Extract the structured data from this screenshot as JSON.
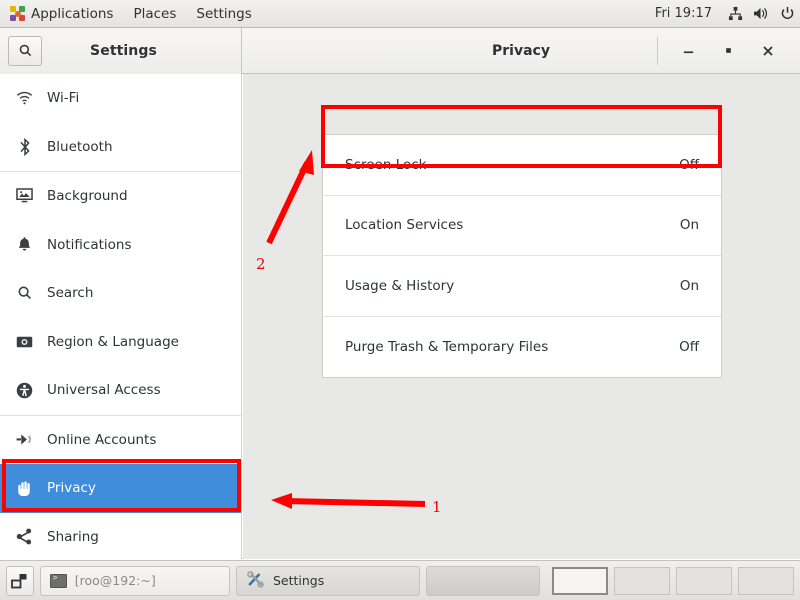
{
  "top_panel": {
    "applications_label": "Applications",
    "places_label": "Places",
    "settings_label": "Settings",
    "clock": "Fri 19:17",
    "tray": [
      "network-icon",
      "volume-icon",
      "power-icon"
    ]
  },
  "window": {
    "sidebar_header_title": "Settings",
    "search_icon": "search-icon",
    "content_title": "Privacy",
    "controls": {
      "minimize": "minimize-icon",
      "maximize": "maximize-icon",
      "close": "close-icon"
    }
  },
  "sidebar": {
    "items": [
      {
        "label": "Wi-Fi",
        "icon": "wifi-icon",
        "selected": false
      },
      {
        "label": "Bluetooth",
        "icon": "bluetooth-icon",
        "selected": false
      },
      {
        "label": "Background",
        "icon": "background-icon",
        "selected": false
      },
      {
        "label": "Notifications",
        "icon": "bell-icon",
        "selected": false
      },
      {
        "label": "Search",
        "icon": "search-icon",
        "selected": false
      },
      {
        "label": "Region & Language",
        "icon": "region-icon",
        "selected": false
      },
      {
        "label": "Universal Access",
        "icon": "accessibility-icon",
        "selected": false
      },
      {
        "label": "Online Accounts",
        "icon": "online-accounts-icon",
        "selected": false
      },
      {
        "label": "Privacy",
        "icon": "hand-icon",
        "selected": true
      },
      {
        "label": "Sharing",
        "icon": "share-icon",
        "selected": false
      }
    ]
  },
  "privacy_panel": {
    "rows": [
      {
        "label": "Screen Lock",
        "value": "Off"
      },
      {
        "label": "Location Services",
        "value": "On"
      },
      {
        "label": "Usage & History",
        "value": "On"
      },
      {
        "label": "Purge Trash & Temporary Files",
        "value": "Off"
      }
    ]
  },
  "annotations": {
    "color": "#ff0000",
    "marks": [
      {
        "number": "1",
        "points_to": "Privacy sidebar item"
      },
      {
        "number": "2",
        "points_to": "Screen Lock row"
      }
    ],
    "highlight_boxes": [
      "screen-lock-row",
      "privacy-sidebar-item"
    ]
  },
  "taskbar": {
    "show_desktop": "show-desktop-icon",
    "tasks": [
      {
        "label": "[roo@192:~]",
        "icon": "terminal-icon",
        "active": false
      },
      {
        "label": "Settings",
        "icon": "tools-icon",
        "active": true
      }
    ],
    "workspaces": [
      {
        "active": true
      },
      {
        "active": false
      },
      {
        "active": false
      },
      {
        "active": false
      }
    ]
  },
  "colors": {
    "selection_blue": "#3f8ddb",
    "annotation_red": "#ff0000",
    "content_bg": "#e8e8e6"
  }
}
